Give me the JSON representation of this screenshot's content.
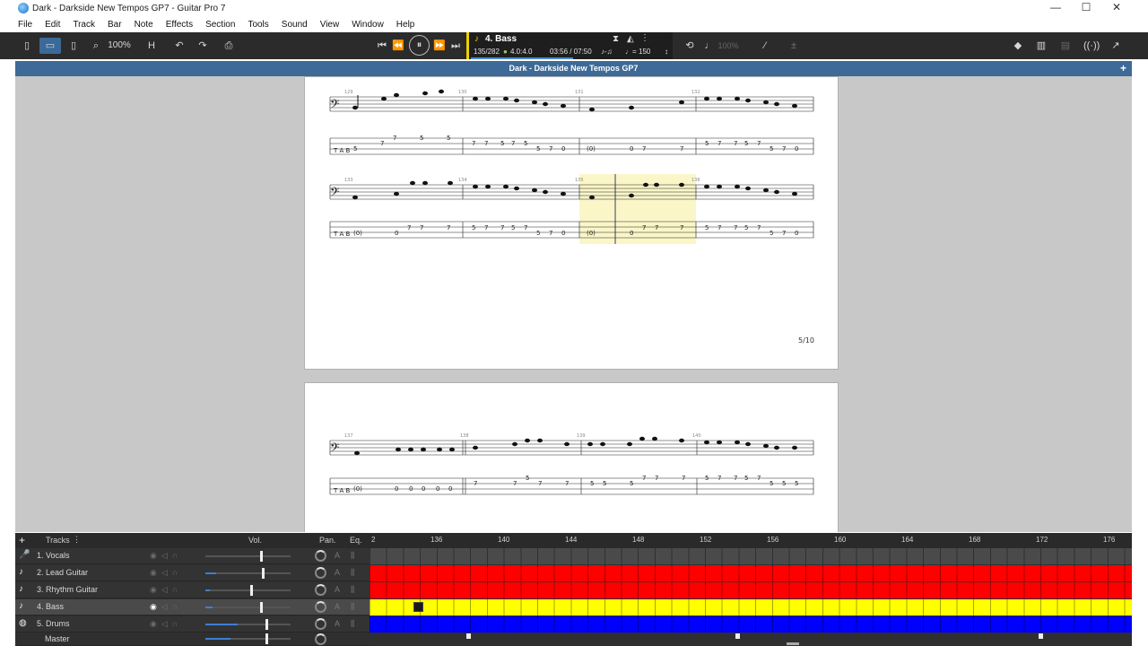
{
  "window": {
    "title": "Dark - Darkside New Tempos GP7 - Guitar Pro 7",
    "controls": {
      "minimize": "—",
      "maximize": "☐",
      "close": "✕"
    }
  },
  "menu": [
    "File",
    "Edit",
    "Track",
    "Bar",
    "Note",
    "Effects",
    "Section",
    "Tools",
    "Sound",
    "View",
    "Window",
    "Help"
  ],
  "toolbar": {
    "zoom": "100%",
    "transport_track": "4. Bass",
    "bar_position": "135/282",
    "time_signature": "4.0:4.0",
    "time_position": "03:56 / 07:50",
    "tempo": "150",
    "speed": "100%"
  },
  "document": {
    "header_title": "Dark - Darkside New Tempos GP7",
    "page_number": "5/10",
    "bar_numbers": [
      "129",
      "130",
      "131",
      "132",
      "133",
      "134",
      "135",
      "136",
      "137",
      "138",
      "139",
      "140"
    ],
    "tab_rows": [
      [
        "5",
        "7",
        "7",
        "5",
        "5",
        "7",
        "7",
        "5",
        "7",
        "5",
        "5",
        "7",
        "0",
        "(0)",
        "0",
        "7",
        "7",
        "5",
        "7",
        "7",
        "5",
        "7",
        "5",
        "7",
        "0"
      ],
      [
        "(0)",
        "0",
        "7",
        "7",
        "7",
        "5",
        "7",
        "7",
        "5",
        "7",
        "5",
        "7",
        "0",
        "(0)",
        "0",
        "7",
        "7",
        "7",
        "5",
        "7",
        "7",
        "5",
        "7",
        "5",
        "7",
        "0"
      ],
      [
        "(0)",
        "0",
        "0",
        "0",
        "0",
        "0",
        "7",
        "7",
        "5",
        "7",
        "7",
        "5",
        "5",
        "5",
        "7",
        "7",
        "7",
        "5",
        "7",
        "7",
        "5",
        "7",
        "5",
        "5",
        "5"
      ]
    ]
  },
  "mixer": {
    "tracks_label": "Tracks",
    "vol_label": "Vol.",
    "pan_label": "Pan.",
    "eq_label": "Eq.",
    "tracks": [
      {
        "name": "1. Vocals",
        "color": "#4a4a4a",
        "volume": 0.65
      },
      {
        "name": "2. Lead Guitar",
        "color": "#ff0000",
        "volume": 0.67
      },
      {
        "name": "3. Rhythm Guitar",
        "color": "#ff0000",
        "volume": 0.55
      },
      {
        "name": "4. Bass",
        "color": "#ffff00",
        "volume": 0.65
      },
      {
        "name": "5. Drums",
        "color": "#0000ff",
        "volume": 0.72
      },
      {
        "name": "Master",
        "color": "#2f2f2f",
        "volume": 0.72
      }
    ],
    "selected_track": "4. Bass",
    "timeline_bars": [
      "2",
      "136",
      "140",
      "144",
      "148",
      "152",
      "156",
      "160",
      "164",
      "168",
      "172",
      "176"
    ]
  },
  "colors": {
    "toolbar_bg": "#2b2b2b",
    "doc_header": "#3d6a96",
    "workspace": "#c8c8c8",
    "playback_highlight": "#fbf6c8",
    "lead_track": "#ff0000",
    "bass_track": "#ffff00",
    "drums_track": "#0000ff"
  },
  "icons": [
    "guitar-pro-app-icon",
    "first-bar-icon",
    "previous-bar-icon",
    "pause-icon",
    "next-bar-icon",
    "last-bar-icon",
    "bass-clef-icon",
    "loop-icon",
    "metronome-icon",
    "countdown-icon",
    "undo-icon",
    "redo-icon",
    "print-icon",
    "zoom-icon",
    "add-track-icon",
    "eye-icon",
    "mute-icon",
    "solo-icon",
    "pan-knob-icon"
  ]
}
